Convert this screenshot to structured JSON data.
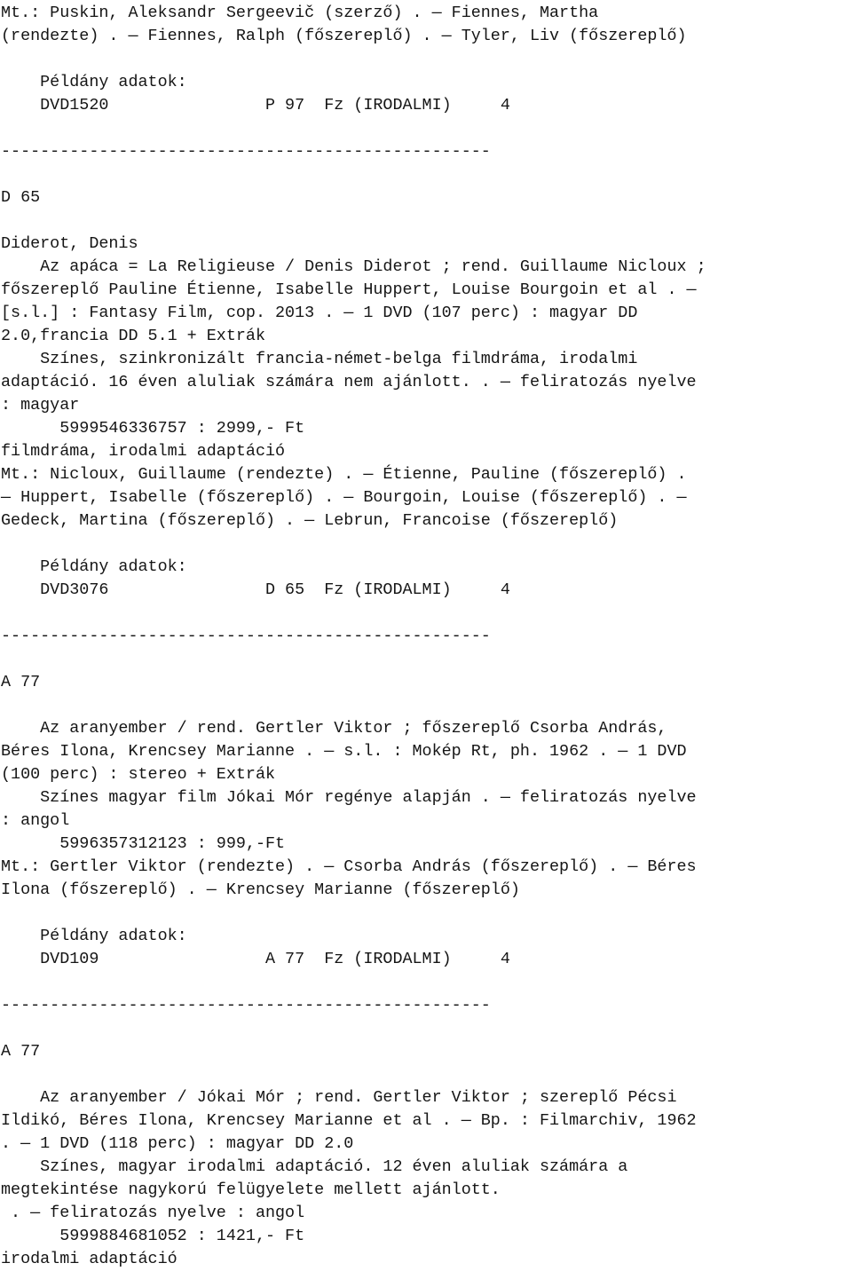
{
  "document": {
    "kind": "library-catalog-printout",
    "language": "hu",
    "separator": "--------------------------------------------------",
    "copy_data_label": "    Példány adatok:",
    "lines": [
      "Mt.: Puskin, Aleksandr Sergeevič (szerző) . — Fiennes, Martha",
      "(rendezte) . — Fiennes, Ralph (főszereplő) . — Tyler, Liv (főszereplő)",
      "",
      "    Példány adatok:",
      "    DVD1520                P 97  Fz (IRODALMI)     4",
      "",
      "--------------------------------------------------",
      "",
      "D 65",
      "",
      "Diderot, Denis",
      "    Az apáca = La Religieuse / Denis Diderot ; rend. Guillaume Nicloux ;",
      "főszereplő Pauline Étienne, Isabelle Huppert, Louise Bourgoin et al . —",
      "[s.l.] : Fantasy Film, cop. 2013 . — 1 DVD (107 perc) : magyar DD",
      "2.0,francia DD 5.1 + Extrák",
      "    Színes, szinkronizált francia-német-belga filmdráma, irodalmi",
      "adaptáció. 16 éven aluliak számára nem ajánlott. . — feliratozás nyelve",
      ": magyar",
      "      5999546336757 : 2999,- Ft",
      "filmdráma, irodalmi adaptáció",
      "Mt.: Nicloux, Guillaume (rendezte) . — Étienne, Pauline (főszereplő) .",
      "— Huppert, Isabelle (főszereplő) . — Bourgoin, Louise (főszereplő) . —",
      "Gedeck, Martina (főszereplő) . — Lebrun, Francoise (főszereplő)",
      "",
      "    Példány adatok:",
      "    DVD3076                D 65  Fz (IRODALMI)     4",
      "",
      "--------------------------------------------------",
      "",
      "A 77",
      "",
      "    Az aranyember / rend. Gertler Viktor ; főszereplő Csorba András,",
      "Béres Ilona, Krencsey Marianne . — s.l. : Mokép Rt, ph. 1962 . — 1 DVD",
      "(100 perc) : stereo + Extrák",
      "    Színes magyar film Jókai Mór regénye alapján . — feliratozás nyelve",
      ": angol",
      "      5996357312123 : 999,-Ft",
      "Mt.: Gertler Viktor (rendezte) . — Csorba András (főszereplő) . — Béres",
      "Ilona (főszereplő) . — Krencsey Marianne (főszereplő)",
      "",
      "    Példány adatok:",
      "    DVD109                 A 77  Fz (IRODALMI)     4",
      "",
      "--------------------------------------------------",
      "",
      "A 77",
      "",
      "    Az aranyember / Jókai Mór ; rend. Gertler Viktor ; szereplő Pécsi",
      "Ildikó, Béres Ilona, Krencsey Marianne et al . — Bp. : Filmarchiv, 1962",
      ". — 1 DVD (118 perc) : magyar DD 2.0",
      "    Színes, magyar irodalmi adaptáció. 12 éven aluliak számára a",
      "megtekintése nagykorú felügyelete mellett ajánlott.",
      " . — feliratozás nyelve : angol",
      "      5999884681052 : 1421,- Ft",
      "irodalmi adaptáció"
    ],
    "records": [
      {
        "id": "record-partial-top",
        "call_number": "",
        "main_entries": "Mt.: Puskin, Aleksandr Sergeevič (szerző) . — Fiennes, Martha (rendezte) . — Fiennes, Ralph (főszereplő) . — Tyler, Liv (főszereplő)",
        "copy": {
          "barcode": "DVD1520",
          "shelf_mark": "P 97",
          "binding": "Fz",
          "collection": "(IRODALMI)",
          "count": "4"
        }
      },
      {
        "id": "record-d65",
        "call_number": "D 65",
        "author": "Diderot, Denis",
        "title_statement": "Az apáca = La Religieuse / Denis Diderot ; rend. Guillaume Nicloux ; főszereplő Pauline Étienne, Isabelle Huppert, Louise Bourgoin et al . — [s.l.] : Fantasy Film, cop. 2013 . — 1 DVD (107 perc) : magyar DD 2.0,francia DD 5.1 + Extrák",
        "note": "Színes, szinkronizált francia-német-belga filmdráma, irodalmi adaptáció. 16 éven aluliak számára nem ajánlott. . — feliratozás nyelve : magyar",
        "isbn_price": "5999546336757 : 2999,- Ft",
        "subjects": "filmdráma, irodalmi adaptáció",
        "main_entries": "Mt.: Nicloux, Guillaume (rendezte) . — Étienne, Pauline (főszereplő) . — Huppert, Isabelle (főszereplő) . — Bourgoin, Louise (főszereplő) . — Gedeck, Martina (főszereplő) . — Lebrun, Francoise (főszereplő)",
        "copy": {
          "barcode": "DVD3076",
          "shelf_mark": "D 65",
          "binding": "Fz",
          "collection": "(IRODALMI)",
          "count": "4"
        }
      },
      {
        "id": "record-a77-first",
        "call_number": "A 77",
        "author": "",
        "title_statement": "Az aranyember / rend. Gertler Viktor ; főszereplő Csorba András, Béres Ilona, Krencsey Marianne . — s.l. : Mokép Rt, ph. 1962 . — 1 DVD (100 perc) : stereo + Extrák",
        "note": "Színes magyar film Jókai Mór regénye alapján . — feliratozás nyelve : angol",
        "isbn_price": "5996357312123 : 999,-Ft",
        "subjects": "",
        "main_entries": "Mt.: Gertler Viktor (rendezte) . — Csorba András (főszereplő) . — Béres Ilona (főszereplő) . — Krencsey Marianne (főszereplő)",
        "copy": {
          "barcode": "DVD109",
          "shelf_mark": "A 77",
          "binding": "Fz",
          "collection": "(IRODALMI)",
          "count": "4"
        }
      },
      {
        "id": "record-a77-second",
        "call_number": "A 77",
        "author": "",
        "title_statement": "Az aranyember / Jókai Mór ; rend. Gertler Viktor ; szereplő Pécsi Ildikó, Béres Ilona, Krencsey Marianne et al . — Bp. : Filmarchiv, 1962 . — 1 DVD (118 perc) : magyar DD 2.0",
        "note": "Színes, magyar irodalmi adaptáció. 12 éven aluliak számára a megtekintése nagykorú felügyelete mellett ajánlott. . — feliratozás nyelve : angol",
        "isbn_price": "5999884681052 : 1421,- Ft",
        "subjects": "irodalmi adaptáció",
        "main_entries": "",
        "copy": null
      }
    ]
  },
  "colors": {
    "background": "#ffffff",
    "text": "#151515"
  }
}
